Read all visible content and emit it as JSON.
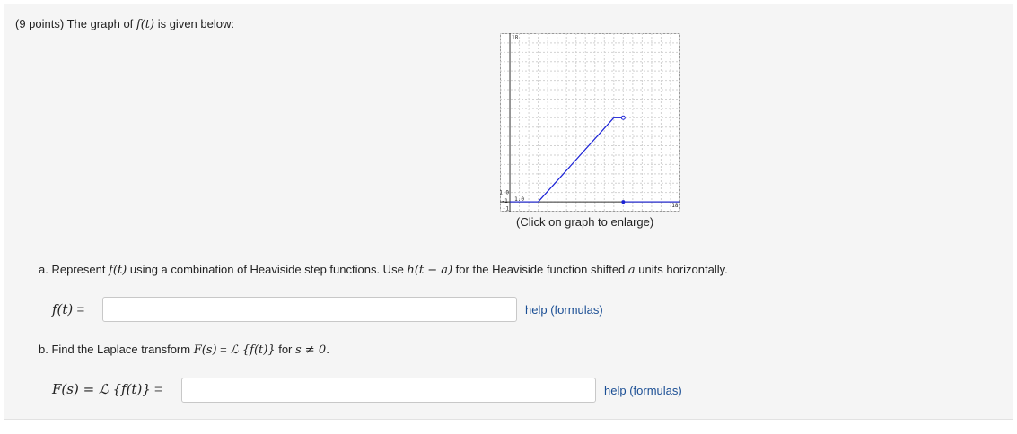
{
  "question": {
    "intro_prefix": "(9 points) The graph of ",
    "f_of_t": "f(t)",
    "intro_suffix": " is given below:",
    "graph_caption": "(Click on graph to enlarge)"
  },
  "graph": {
    "y_top_label": "18",
    "y_tick_label": "1.0",
    "x_tick_label": "1.0",
    "x_right_label": "18",
    "x_left_label": "-1",
    "y_bottom_label": "-1",
    "line_color": "#1b22d6"
  },
  "chart_data": {
    "type": "line",
    "xlim": [
      -1,
      18
    ],
    "ylim": [
      -1,
      18
    ],
    "grid": true,
    "segments": [
      {
        "x": [
          0,
          3
        ],
        "y": [
          0,
          0
        ]
      },
      {
        "x": [
          3,
          11
        ],
        "y": [
          0,
          9
        ]
      },
      {
        "x": [
          11,
          12
        ],
        "y": [
          9,
          9
        ],
        "end": "open"
      },
      {
        "x": [
          12,
          18
        ],
        "y": [
          0,
          0
        ],
        "start": "closed"
      }
    ]
  },
  "part_a": {
    "prefix": "a. Represent ",
    "f_of_t": "f(t)",
    "middle": " using a combination of Heaviside step functions. Use ",
    "h_expr": "h(t − a)",
    "middle2": " for the Heaviside function shifted ",
    "a_var": "a",
    "suffix": " units horizontally.",
    "answer_label": "f(t)",
    "equals": "=",
    "answer_value": "",
    "help": "help (formulas)"
  },
  "part_b": {
    "prefix": "b. Find the Laplace transform ",
    "F_of_s": "F(s)",
    "eq1": " = ",
    "L_expr": "ℒ {f(t)}",
    "for_text": " for ",
    "cond": "s ≠ 0.",
    "answer_label": "F(s) = ℒ {f(t)}",
    "equals": "=",
    "answer_value": "",
    "help": "help (formulas)"
  }
}
